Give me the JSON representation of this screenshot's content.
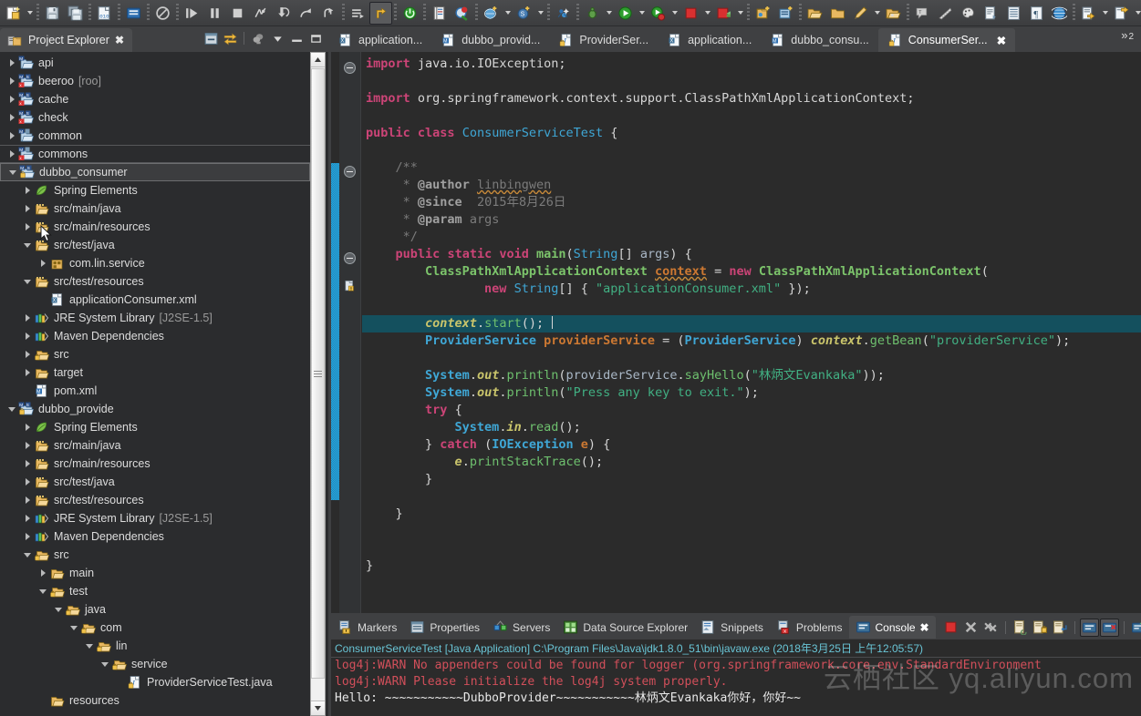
{
  "toolbar": {
    "items": [
      {
        "name": "new-wizard-icon",
        "kind": "new",
        "arrow": true
      },
      {
        "sep": true
      },
      {
        "name": "save-icon",
        "kind": "save"
      },
      {
        "name": "save-all-icon",
        "kind": "saveall"
      },
      {
        "sep": true
      },
      {
        "name": "new-java-class-icon",
        "kind": "binfile"
      },
      {
        "sepdot": true
      },
      {
        "name": "open-task-icon",
        "kind": "bluebox"
      },
      {
        "sepdot": true
      },
      {
        "name": "skip-breakpoints-icon",
        "kind": "noentry"
      },
      {
        "sep": true
      },
      {
        "name": "resume-icon",
        "kind": "resume"
      },
      {
        "name": "suspend-icon",
        "kind": "suspend"
      },
      {
        "name": "terminate-icon",
        "kind": "stopgray"
      },
      {
        "name": "disconnect-icon",
        "kind": "disconnect"
      },
      {
        "name": "step-into-icon",
        "kind": "stepinto"
      },
      {
        "name": "step-over-icon",
        "kind": "stepover"
      },
      {
        "name": "step-return-icon",
        "kind": "stepreturn"
      },
      {
        "sep": true
      },
      {
        "name": "instruction-stepping-icon",
        "kind": "instr"
      },
      {
        "name": "toggle-mode-icon",
        "kind": "yellowarrow",
        "pressed": true
      },
      {
        "sepdot": true
      },
      {
        "name": "server-power-icon",
        "kind": "power"
      },
      {
        "sepdot": true
      },
      {
        "name": "open-type-icon",
        "kind": "booklist"
      },
      {
        "name": "search-icon",
        "kind": "redsearch"
      },
      {
        "sepdot": true
      },
      {
        "name": "new-web-icon",
        "kind": "webnew",
        "arrow": true
      },
      {
        "name": "new-svn-icon",
        "kind": "svnnew",
        "arrow": true
      },
      {
        "sepdot": true
      },
      {
        "name": "run-ant-icon",
        "kind": "ant"
      },
      {
        "sepdot": true
      },
      {
        "name": "debug-icon",
        "kind": "debugbug",
        "arrow": true
      },
      {
        "name": "run-icon",
        "kind": "rungreen",
        "arrow": true
      },
      {
        "name": "run-last-icon",
        "kind": "runred",
        "arrow": true
      },
      {
        "name": "terminate-red-icon",
        "kind": "stopred",
        "arrow": true
      },
      {
        "name": "external-tools-icon",
        "kind": "exttool",
        "arrow": true
      },
      {
        "sepdot": true
      },
      {
        "name": "new-spring-project-icon",
        "kind": "springnew"
      },
      {
        "name": "new-spring-element-icon",
        "kind": "springelem"
      },
      {
        "sepdot": true
      },
      {
        "name": "open-folder-icon",
        "kind": "folderopen"
      },
      {
        "name": "folder-icon",
        "kind": "folder2"
      },
      {
        "name": "edit-icon",
        "kind": "pencil",
        "arrow": true
      },
      {
        "name": "open-resource-icon",
        "kind": "folderopen2"
      },
      {
        "sepdot": true
      },
      {
        "name": "comment-icon",
        "kind": "speech"
      },
      {
        "name": "ruler-icon",
        "kind": "ruler"
      },
      {
        "name": "palette-icon",
        "kind": "palette"
      },
      {
        "name": "document-icon",
        "kind": "doc"
      },
      {
        "name": "list-icon",
        "kind": "listdoc"
      },
      {
        "name": "paragraph-icon",
        "kind": "para"
      },
      {
        "name": "browser-icon",
        "kind": "globe"
      },
      {
        "sepdot": true
      },
      {
        "name": "import-icon",
        "kind": "import",
        "arrow": true
      },
      {
        "name": "export-icon",
        "kind": "export",
        "arrow": true
      },
      {
        "name": "back-icon",
        "kind": "backarrow"
      },
      {
        "name": "forward-icon",
        "kind": "fwdarrow"
      }
    ]
  },
  "project_explorer": {
    "tab_label": "Project Explorer",
    "tools": [
      "collapse-all-icon",
      "link-with-editor-icon",
      "view-menu-icon",
      "minimize-icon",
      "maximize-icon"
    ],
    "tree": [
      {
        "label": "api",
        "indent": 0,
        "twist": "closed",
        "icon": "maven-project"
      },
      {
        "label": "beeroo",
        "sub": "[roo]",
        "indent": 0,
        "twist": "closed",
        "icon": "maven-spring-project"
      },
      {
        "label": "cache",
        "indent": 0,
        "twist": "closed",
        "icon": "maven-spring-project"
      },
      {
        "label": "check",
        "indent": 0,
        "twist": "closed",
        "icon": "maven-spring-project"
      },
      {
        "label": "common",
        "indent": 0,
        "twist": "closed",
        "icon": "maven-java-project"
      },
      {
        "label": "commons",
        "indent": 0,
        "twist": "closed",
        "icon": "maven-xml-project",
        "hover": true
      },
      {
        "label": "dubbo_consumer",
        "indent": 0,
        "twist": "open",
        "icon": "maven-spring-lock-project",
        "selected": true
      },
      {
        "label": "Spring Elements",
        "indent": 1,
        "twist": "closed",
        "icon": "spring-leaf"
      },
      {
        "label": "src/main/java",
        "indent": 1,
        "twist": "closed",
        "icon": "source-folder"
      },
      {
        "label": "src/main/resources",
        "indent": 1,
        "twist": "closed",
        "icon": "source-folder"
      },
      {
        "label": "src/test/java",
        "indent": 1,
        "twist": "open",
        "icon": "source-folder"
      },
      {
        "label": "com.lin.service",
        "indent": 2,
        "twist": "closed",
        "icon": "package"
      },
      {
        "label": "src/test/resources",
        "indent": 1,
        "twist": "open",
        "icon": "source-folder"
      },
      {
        "label": "applicationConsumer.xml",
        "indent": 2,
        "twist": "none",
        "icon": "xml-file"
      },
      {
        "label": "JRE System Library",
        "sub": "[J2SE-1.5]",
        "indent": 1,
        "twist": "closed",
        "icon": "library"
      },
      {
        "label": "Maven Dependencies",
        "indent": 1,
        "twist": "closed",
        "icon": "library"
      },
      {
        "label": "src",
        "indent": 1,
        "twist": "closed",
        "icon": "folder-lock"
      },
      {
        "label": "target",
        "indent": 1,
        "twist": "closed",
        "icon": "folder"
      },
      {
        "label": "pom.xml",
        "indent": 1,
        "twist": "none",
        "icon": "maven-file"
      },
      {
        "label": "dubbo_provide",
        "indent": 0,
        "twist": "open",
        "icon": "maven-spring-lock-project"
      },
      {
        "label": "Spring Elements",
        "indent": 1,
        "twist": "closed",
        "icon": "spring-leaf"
      },
      {
        "label": "src/main/java",
        "indent": 1,
        "twist": "closed",
        "icon": "source-folder"
      },
      {
        "label": "src/main/resources",
        "indent": 1,
        "twist": "closed",
        "icon": "source-folder"
      },
      {
        "label": "src/test/java",
        "indent": 1,
        "twist": "closed",
        "icon": "source-folder"
      },
      {
        "label": "src/test/resources",
        "indent": 1,
        "twist": "closed",
        "icon": "source-folder"
      },
      {
        "label": "JRE System Library",
        "sub": "[J2SE-1.5]",
        "indent": 1,
        "twist": "closed",
        "icon": "library"
      },
      {
        "label": "Maven Dependencies",
        "indent": 1,
        "twist": "closed",
        "icon": "library"
      },
      {
        "label": "src",
        "indent": 1,
        "twist": "open",
        "icon": "folder-lock"
      },
      {
        "label": "main",
        "indent": 2,
        "twist": "closed",
        "icon": "folder"
      },
      {
        "label": "test",
        "indent": 2,
        "twist": "open",
        "icon": "folder-lock"
      },
      {
        "label": "java",
        "indent": 3,
        "twist": "open",
        "icon": "folder-lock"
      },
      {
        "label": "com",
        "indent": 4,
        "twist": "open",
        "icon": "folder-lock"
      },
      {
        "label": "lin",
        "indent": 5,
        "twist": "open",
        "icon": "folder-lock"
      },
      {
        "label": "service",
        "indent": 6,
        "twist": "open",
        "icon": "folder-lock"
      },
      {
        "label": "ProviderServiceTest.java",
        "indent": 7,
        "twist": "none",
        "icon": "java-file-lock"
      },
      {
        "label": "resources",
        "indent": 2,
        "twist": "none",
        "icon": "folder"
      }
    ]
  },
  "editor": {
    "tabs": [
      {
        "label": "application...",
        "icon": "xml-file",
        "active": false
      },
      {
        "label": "dubbo_provid...",
        "icon": "maven-file",
        "active": false
      },
      {
        "label": "ProviderSer...",
        "icon": "java-file-lock",
        "active": false
      },
      {
        "label": "application...",
        "icon": "xml-file",
        "active": false
      },
      {
        "label": "dubbo_consu...",
        "icon": "maven-file",
        "active": false
      },
      {
        "label": "ConsumerSer...",
        "icon": "java-file-lock",
        "active": true,
        "close": "✖"
      }
    ],
    "overflow_label": "»",
    "overflow_count": "2",
    "code_lines": [
      {
        "html": "<span class=\"kw\">import</span> <span class=\"id\">java</span><span class=\"id\">.</span><span class=\"id\">io</span><span class=\"id\">.</span><span class=\"id\">IOException</span><span class=\"id\">;</span>"
      },
      {
        "html": ""
      },
      {
        "html": "<span class=\"kw\">import</span> <span class=\"id\">org.springframework.context.support.ClassPathXmlApplicationContext;</span>"
      },
      {
        "html": ""
      },
      {
        "html": "<span class=\"kw\">public</span> <span class=\"kw\">class</span> <span class=\"cls\">ConsumerServiceTest</span> <span class=\"id\">{</span>"
      },
      {
        "html": ""
      },
      {
        "html": "    <span class=\"cmt\">/**</span>"
      },
      {
        "html": "     <span class=\"cmt\">*</span> <span class=\"cmtb\">@author</span> <span class=\"cmt sqg\">linbingwen</span>"
      },
      {
        "html": "     <span class=\"cmt\">*</span> <span class=\"cmtb\">@since</span>  <span class=\"cmt\">2015年8月26日</span>"
      },
      {
        "html": "     <span class=\"cmt\">*</span> <span class=\"cmtb\">@param</span> <span class=\"cmt\">args</span>"
      },
      {
        "html": "     <span class=\"cmt\">*/</span>"
      },
      {
        "html": "    <span class=\"kw\">public</span> <span class=\"kw\">static</span> <span class=\"kw\">void</span> <span class=\"typ2\">main</span><span class=\"id\">(</span><span class=\"cls\">String</span><span class=\"id\">[] </span><span class=\"var\">args</span><span class=\"id\">) {</span>"
      },
      {
        "html": "        <span class=\"typ2\">ClassPathXmlApplicationContext</span> <span class=\"varo sqg\">context</span> <span class=\"id\">= </span><span class=\"kw\">new</span> <span class=\"typ2\">ClassPathXmlApplicationContext</span><span class=\"id\">(</span>"
      },
      {
        "html": "                <span class=\"kw\">new</span> <span class=\"cls\">String</span><span class=\"id\">[] { </span><span class=\"str\">\"applicationConsumer.xml\"</span><span class=\"id\"> });</span>"
      },
      {
        "html": ""
      },
      {
        "html": "        <span class=\"fld\">context</span><span class=\"id\">.</span><span class=\"mth\">start</span><span class=\"id\">();</span> ",
        "current": true,
        "caret": true
      },
      {
        "html": "        <span class=\"typ\">ProviderService</span> <span class=\"varo\">providerService</span> <span class=\"id\">= (</span><span class=\"typ\">ProviderService</span><span class=\"id\">) </span><span class=\"fld\">context</span><span class=\"id\">.</span><span class=\"mth\">getBean</span><span class=\"id\">(</span><span class=\"str\">\"providerService\"</span><span class=\"id\">);</span>"
      },
      {
        "html": ""
      },
      {
        "html": "        <span class=\"typ\">System</span><span class=\"id\">.</span><span class=\"fld\">out</span><span class=\"id\">.</span><span class=\"mth\">println</span><span class=\"id\">(</span><span class=\"var\">providerService</span><span class=\"id\">.</span><span class=\"mth\">sayHello</span><span class=\"id\">(</span><span class=\"str\">\"林炳文Evankaka\"</span><span class=\"id\">));</span>"
      },
      {
        "html": "        <span class=\"typ\">System</span><span class=\"id\">.</span><span class=\"fld\">out</span><span class=\"id\">.</span><span class=\"mth\">println</span><span class=\"id\">(</span><span class=\"str\">\"Press any key to exit.\"</span><span class=\"id\">);</span>"
      },
      {
        "html": "        <span class=\"kw\">try</span> <span class=\"id\">{</span>"
      },
      {
        "html": "            <span class=\"typ\">System</span><span class=\"id\">.</span><span class=\"fld\">in</span><span class=\"id\">.</span><span class=\"mth\">read</span><span class=\"id\">();</span>"
      },
      {
        "html": "        <span class=\"id\">} </span><span class=\"kw\">catch</span> <span class=\"id\">(</span><span class=\"typ\">IOException</span> <span class=\"varo\">e</span><span class=\"id\">) {</span>"
      },
      {
        "html": "            <span class=\"fld\">e</span><span class=\"id\">.</span><span class=\"mth\">printStackTrace</span><span class=\"id\">();</span>"
      },
      {
        "html": "        <span class=\"id\">}</span>"
      },
      {
        "html": ""
      },
      {
        "html": "    <span class=\"id\">}</span>"
      },
      {
        "html": ""
      },
      {
        "html": ""
      },
      {
        "html": "<span class=\"id\">}</span>"
      }
    ]
  },
  "console_panel": {
    "tabs": [
      {
        "label": "Markers",
        "icon": "markers-icon",
        "active": false
      },
      {
        "label": "Properties",
        "icon": "properties-icon",
        "active": false
      },
      {
        "label": "Servers",
        "icon": "servers-icon",
        "active": false
      },
      {
        "label": "Data Source Explorer",
        "icon": "data-source-icon",
        "active": false
      },
      {
        "label": "Snippets",
        "icon": "snippets-icon",
        "active": false
      },
      {
        "label": "Problems",
        "icon": "problems-icon",
        "active": false
      },
      {
        "label": "Console",
        "icon": "console-icon",
        "active": true,
        "close": "✖"
      }
    ],
    "tools": [
      {
        "name": "terminate-button",
        "kind": "stopred"
      },
      {
        "name": "remove-launch-button",
        "kind": "grayx"
      },
      {
        "name": "remove-all-terminated-button",
        "kind": "grayxx"
      },
      {
        "name": "clear-console-button",
        "kind": "clear"
      },
      {
        "name": "scroll-lock-button",
        "kind": "scrolllock"
      },
      {
        "name": "word-wrap-button",
        "kind": "wrap"
      },
      {
        "name": "pin-console-button",
        "kind": "pinned",
        "boxed": true
      },
      {
        "name": "display-selected-console-button",
        "kind": "displaysel",
        "boxed": true
      },
      {
        "name": "open-console-button",
        "kind": "opencons"
      }
    ],
    "header": "ConsumerServiceTest [Java Application] C:\\Program Files\\Java\\jdk1.8.0_51\\bin\\javaw.exe (2018年3月25日 上午12:05:57)",
    "output": [
      {
        "text": "log4j:WARN No appenders could be found for logger (org.springframework.core.env.StandardEnvironment",
        "type": "err"
      },
      {
        "text": "log4j:WARN Please initialize the log4j system properly.",
        "type": "err"
      },
      {
        "text": "Hello: ~~~~~~~~~~~DubboProvider~~~~~~~~~~~林炳文Evankaka你好，你好~~",
        "type": "out"
      }
    ]
  },
  "watermark": {
    "text": "云栖社区 yq.aliyun.com"
  },
  "colors": {
    "chrome": "#3f4042",
    "panel_bg": "#2b2c2e",
    "editor_bg": "#2b2b2b",
    "current_line": "#14505e",
    "accent_tab": "#4b4c4e",
    "console_header": "#69c5d6",
    "error_text": "#d14f5a",
    "change_bar": "#1d86bb"
  }
}
